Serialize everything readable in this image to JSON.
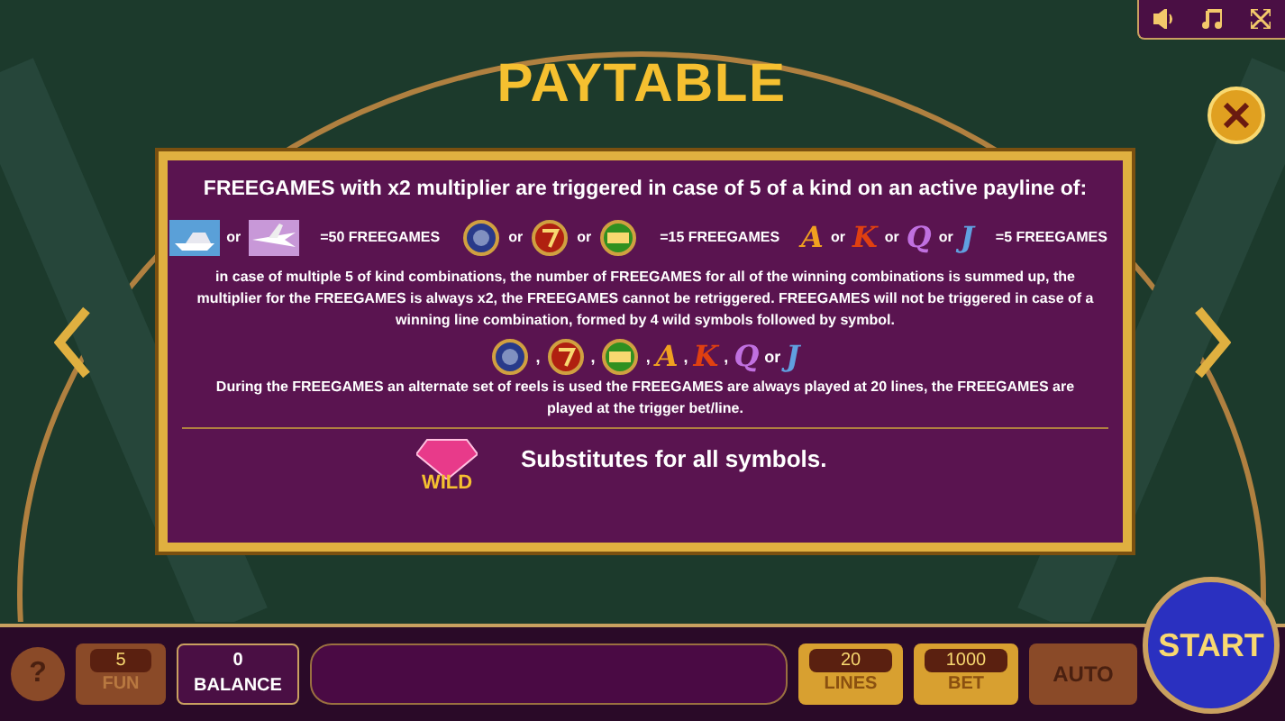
{
  "title": "PAYTABLE",
  "rules": {
    "heading": "FREEGAMES with x2 multiplier are triggered in case of 5 of a kind on an active payline of:",
    "symbol_row": [
      {
        "kind": "yacht"
      },
      {
        "kind": "text",
        "text": "or"
      },
      {
        "kind": "jet"
      },
      {
        "kind": "award",
        "text": "=50 FREEGAMES"
      },
      {
        "kind": "watch"
      },
      {
        "kind": "text",
        "text": "or"
      },
      {
        "kind": "seven"
      },
      {
        "kind": "text",
        "text": "or"
      },
      {
        "kind": "bar"
      },
      {
        "kind": "award",
        "text": "=15 FREEGAMES"
      },
      {
        "kind": "letter",
        "text": "A",
        "color": "#f0a020"
      },
      {
        "kind": "text",
        "text": "or"
      },
      {
        "kind": "letter",
        "text": "K",
        "color": "#e04010"
      },
      {
        "kind": "text",
        "text": "or"
      },
      {
        "kind": "letter",
        "text": "Q",
        "color": "#c070e0"
      },
      {
        "kind": "text",
        "text": "or"
      },
      {
        "kind": "letter",
        "text": "J",
        "color": "#60a0e0"
      },
      {
        "kind": "award",
        "text": "=5 FREEGAMES"
      }
    ],
    "paragraph": "in case of multiple 5 of kind combinations, the number of FREEGAMES for all of the winning combinations is summed up, the multiplier for the FREEGAMES is always x2, the FREEGAMES cannot be retriggered. FREEGAMES will not be triggered in case of a winning line combination, formed by 4 wild symbols followed by symbol.",
    "reel_row": [
      {
        "kind": "watch"
      },
      {
        "kind": "text",
        "text": ","
      },
      {
        "kind": "seven"
      },
      {
        "kind": "text",
        "text": ","
      },
      {
        "kind": "bar"
      },
      {
        "kind": "text",
        "text": ","
      },
      {
        "kind": "letter",
        "text": "A",
        "color": "#f0a020"
      },
      {
        "kind": "text",
        "text": ","
      },
      {
        "kind": "letter",
        "text": "K",
        "color": "#e04010"
      },
      {
        "kind": "text",
        "text": ","
      },
      {
        "kind": "letter",
        "text": "Q",
        "color": "#c070e0"
      },
      {
        "kind": "text",
        "text": "or"
      },
      {
        "kind": "letter",
        "text": "J",
        "color": "#60a0e0"
      }
    ],
    "reels_note": "During the FREEGAMES an alternate set of reels is used the FREEGAMES are always played at 20 lines, the FREEGAMES are played at the trigger bet/line."
  },
  "wild": {
    "label": "WILD",
    "text": "Substitutes for all symbols."
  },
  "bottom_bar": {
    "help": "?",
    "fun": {
      "value": "5",
      "label": "FUN"
    },
    "balance": {
      "value": "0",
      "label": "BALANCE"
    },
    "lines": {
      "value": "20",
      "label": "LINES"
    },
    "bet": {
      "value": "1000",
      "label": "BET"
    },
    "auto": "AUTO",
    "start": "START"
  }
}
